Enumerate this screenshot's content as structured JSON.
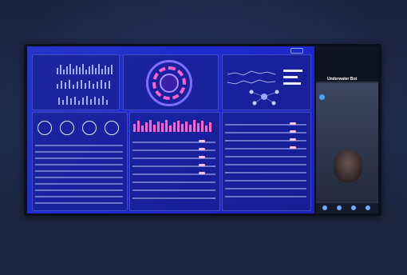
{
  "photo": {
    "phone_title": "Underwater Bot"
  }
}
